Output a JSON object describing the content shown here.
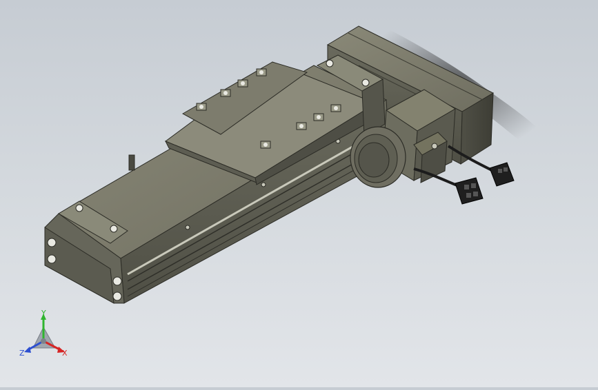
{
  "viewport": {
    "background_top": "#c6ccd3",
    "background_bottom": "#e2e5e9",
    "model_color": "#7b7a6c",
    "cable_color": "#1c1c1c"
  },
  "triad": {
    "x_label": "X",
    "y_label": "Y",
    "z_label": "Z",
    "x_color": "#d62424",
    "y_color": "#2fb52f",
    "z_color": "#2d4fd0"
  },
  "model": {
    "parts": [
      "linear-actuator-body",
      "slider-carriage",
      "end-block",
      "servo-motor",
      "motor-fan-cover",
      "cable-connector-1",
      "cable-connector-2"
    ]
  }
}
